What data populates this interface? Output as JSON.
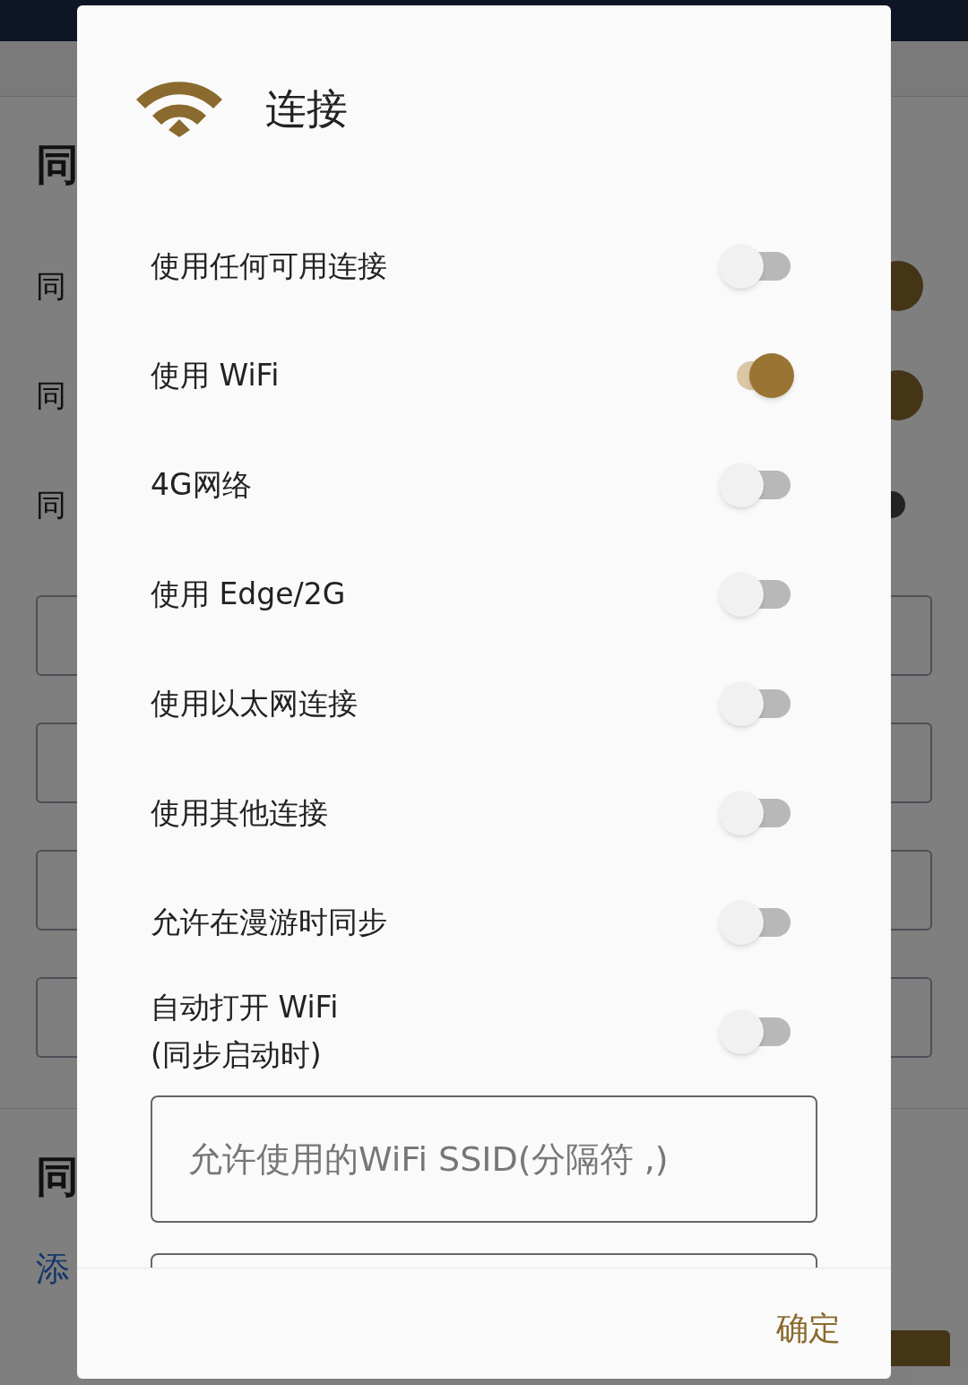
{
  "background": {
    "headings": [
      "同",
      "同"
    ],
    "rows": [
      {
        "label": "同",
        "on": true
      },
      {
        "label": "同",
        "on": true
      },
      {
        "label": "同",
        "on": false
      }
    ],
    "link": "添"
  },
  "dialog": {
    "title": "连接",
    "options": [
      {
        "label": "使用任何可用连接",
        "on": false
      },
      {
        "label": "使用 WiFi",
        "on": true
      },
      {
        "label": "4G网络",
        "on": false
      },
      {
        "label": "使用 Edge/2G",
        "on": false
      },
      {
        "label": "使用以太网连接",
        "on": false
      },
      {
        "label": "使用其他连接",
        "on": false
      },
      {
        "label": "允许在漫游时同步",
        "on": false
      },
      {
        "label": "自动打开 WiFi\n(同步启动时)",
        "on": false
      }
    ],
    "ssid_field": {
      "placeholder": "允许使用的WiFi SSID(分隔符 ,)"
    },
    "button": "确定"
  }
}
